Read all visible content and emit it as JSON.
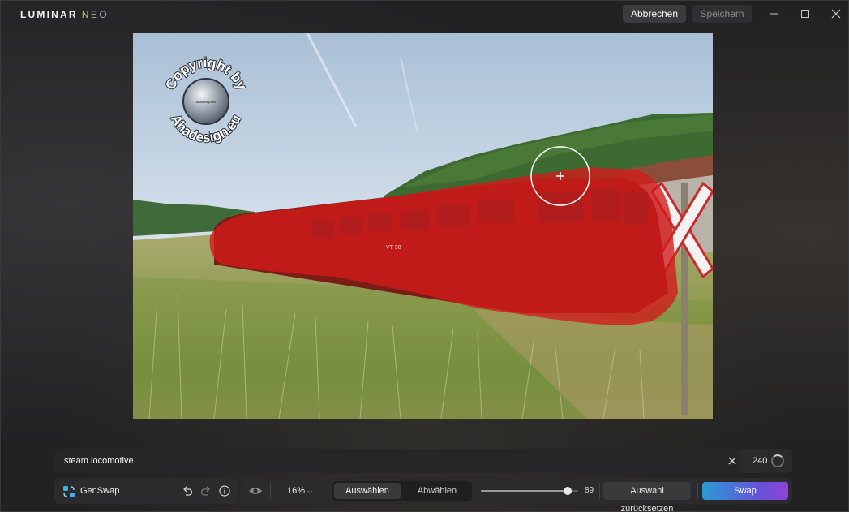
{
  "app": {
    "logo_main": "LUMINAR",
    "logo_sub": "NEO",
    "cancel_label": "Abbrechen",
    "save_label": "Speichern"
  },
  "window_controls": {
    "minimize_icon": "minimize-icon",
    "maximize_icon": "maximize-icon",
    "close_icon": "close-icon"
  },
  "canvas": {
    "watermark_top": "Copyright by",
    "watermark_bottom": "Ahadesign.eu",
    "watermark_center": "Ahadesign.eu",
    "train_plate": "VT 98",
    "mask_color": "#d41a1a",
    "cursor_icon": "brush-cursor-icon"
  },
  "prompt": {
    "value": "steam locomotive",
    "count": "240",
    "clear_icon": "clear-icon",
    "spinner_icon": "spinner-icon"
  },
  "toolbar": {
    "tool_name": "GenSwap",
    "tool_icon": "genswap-icon",
    "undo_icon": "undo-icon",
    "redo_icon": "redo-icon",
    "info_icon": "info-icon",
    "eye_icon": "eye-icon",
    "zoom": "16%",
    "select_label": "Auswählen",
    "deselect_label": "Abwählen",
    "brush_size": "89",
    "brush_size_max": 100,
    "reset_label": "Auswahl zurücksetzen",
    "swap_label": "Swap",
    "swap_gradient": [
      "#2a9bd6",
      "#8e44d8"
    ]
  }
}
